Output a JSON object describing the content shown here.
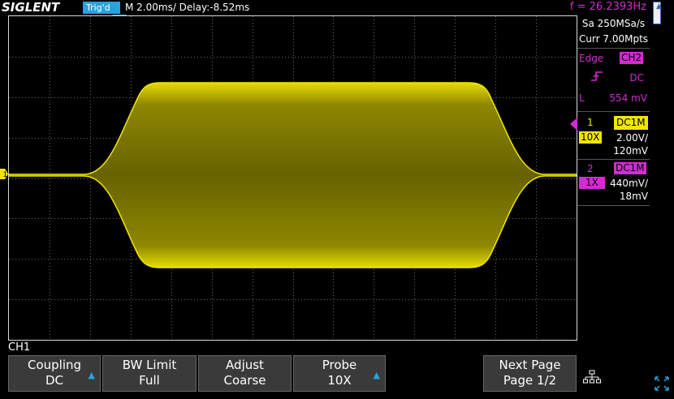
{
  "header": {
    "logo": "SIGLENT",
    "trigger_status": "Trig'd",
    "timebase": "M 2.00ms/ Delay:-8.52ms",
    "frequency": "f = 26.2393Hz"
  },
  "acquisition": {
    "sample_rate": "Sa 250MSa/s",
    "memory_depth": "Curr 7.00Mpts"
  },
  "trigger": {
    "type_label": "Edge",
    "source": "CH2",
    "coupling": "DC",
    "level_label": "L",
    "level_value": "554 mV"
  },
  "channels": [
    {
      "number": "1",
      "coupling": "DC1M",
      "probe": "10X",
      "scale": "2.00V/",
      "offset": "120mV",
      "color": "#f2e600"
    },
    {
      "number": "2",
      "coupling": "DC1M",
      "probe": "1X",
      "scale": "440mV/",
      "offset": "18mV",
      "color": "#d52bd2"
    }
  ],
  "menu": {
    "title": "CH1",
    "softkeys": [
      {
        "label": "Coupling",
        "value": "DC",
        "has_arrow": true
      },
      {
        "label": "BW Limit",
        "value": "Full",
        "has_arrow": false
      },
      {
        "label": "Adjust",
        "value": "Coarse",
        "has_arrow": false
      },
      {
        "label": "Probe",
        "value": "10X",
        "has_arrow": true
      },
      {
        "label": "Next Page",
        "value": "Page 1/2",
        "has_arrow": false
      }
    ]
  },
  "icons": {
    "network": "network-icon",
    "expand": "expand-icon",
    "ch1_marker_label": "1"
  },
  "colors": {
    "ch1": "#f2e600",
    "ch2": "#d52bd2",
    "accent": "#29a3dc"
  }
}
